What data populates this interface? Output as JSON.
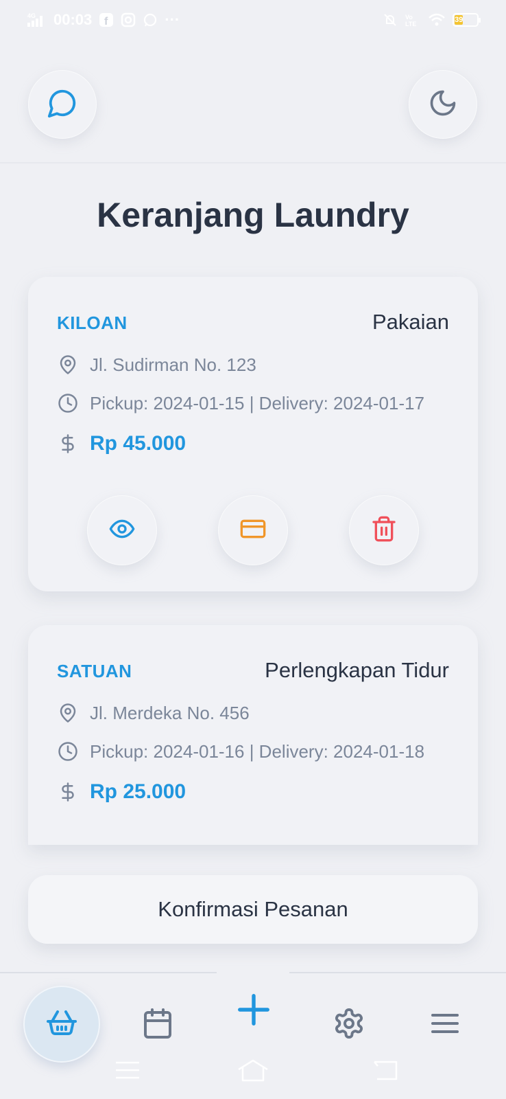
{
  "status_bar": {
    "network": "4G",
    "time": "00:03",
    "more": "···",
    "battery": "39",
    "left_icons": [
      "signal-icon",
      "facebook-icon",
      "instagram-icon",
      "whatsapp-icon"
    ],
    "right_icons": [
      "mute-icon",
      "volte-icon",
      "wifi-icon",
      "battery-icon"
    ]
  },
  "header": {
    "chat_icon": "chat-bubble-icon",
    "theme_icon": "moon-icon"
  },
  "page": {
    "title": "Keranjang Laundry"
  },
  "orders": [
    {
      "type": "KILOAN",
      "category": "Pakaian",
      "address": "Jl. Sudirman No. 123",
      "schedule": "Pickup: 2024-01-15 | Delivery: 2024-01-17",
      "price": "Rp 45.000"
    },
    {
      "type": "SATUAN",
      "category": "Perlengkapan Tidur",
      "address": "Jl. Merdeka No. 456",
      "schedule": "Pickup: 2024-01-16 | Delivery: 2024-01-18",
      "price": "Rp 25.000"
    }
  ],
  "actions": {
    "view_icon": "eye-icon",
    "pay_icon": "credit-card-icon",
    "delete_icon": "trash-icon"
  },
  "confirm": {
    "label": "Konfirmasi Pesanan"
  },
  "bottom_nav": {
    "items": [
      "basket-icon",
      "calendar-icon",
      "plus-icon",
      "gear-icon",
      "menu-icon"
    ],
    "active": "basket-icon"
  },
  "colors": {
    "accent": "#2196de",
    "background": "#eff0f4",
    "text_dark": "#2a3344",
    "text_muted": "#7b8699",
    "pay_orange": "#f0962a",
    "delete_red": "#f0505a"
  }
}
